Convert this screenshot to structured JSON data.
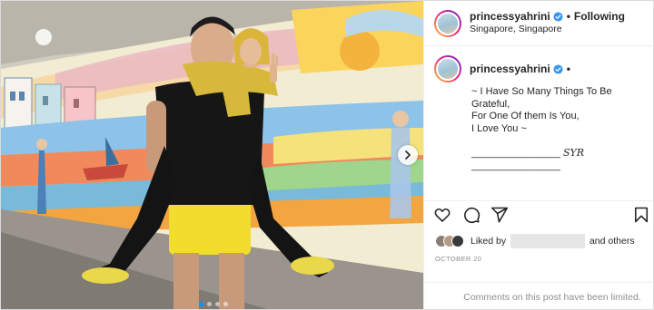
{
  "post": {
    "username": "princessyahrini",
    "follow_status": "Following",
    "separator": "•",
    "location": "Singapore, Singapore"
  },
  "caption": {
    "username": "princessyahrini",
    "dot": "•",
    "lines": [
      "~ I Have So Many Things To Be Grateful,",
      "For One Of them Is You,",
      "I Love You ~"
    ],
    "signature_line": "________________",
    "signature": "SYR",
    "signature_line2": "________________"
  },
  "actions": {
    "icons": [
      "heart-icon",
      "comment-icon",
      "share-icon",
      "bookmark-icon"
    ]
  },
  "likes": {
    "prefix": "Liked by",
    "suffix": "and others"
  },
  "date": "OCTOBER 20",
  "comments_notice": "Comments on this post have been limited.",
  "carousel": {
    "total": 4,
    "current": 1
  },
  "colors": {
    "accent": "#0095f6",
    "text": "#262626",
    "muted": "#8e8e8e",
    "verified": "#3897f0"
  }
}
